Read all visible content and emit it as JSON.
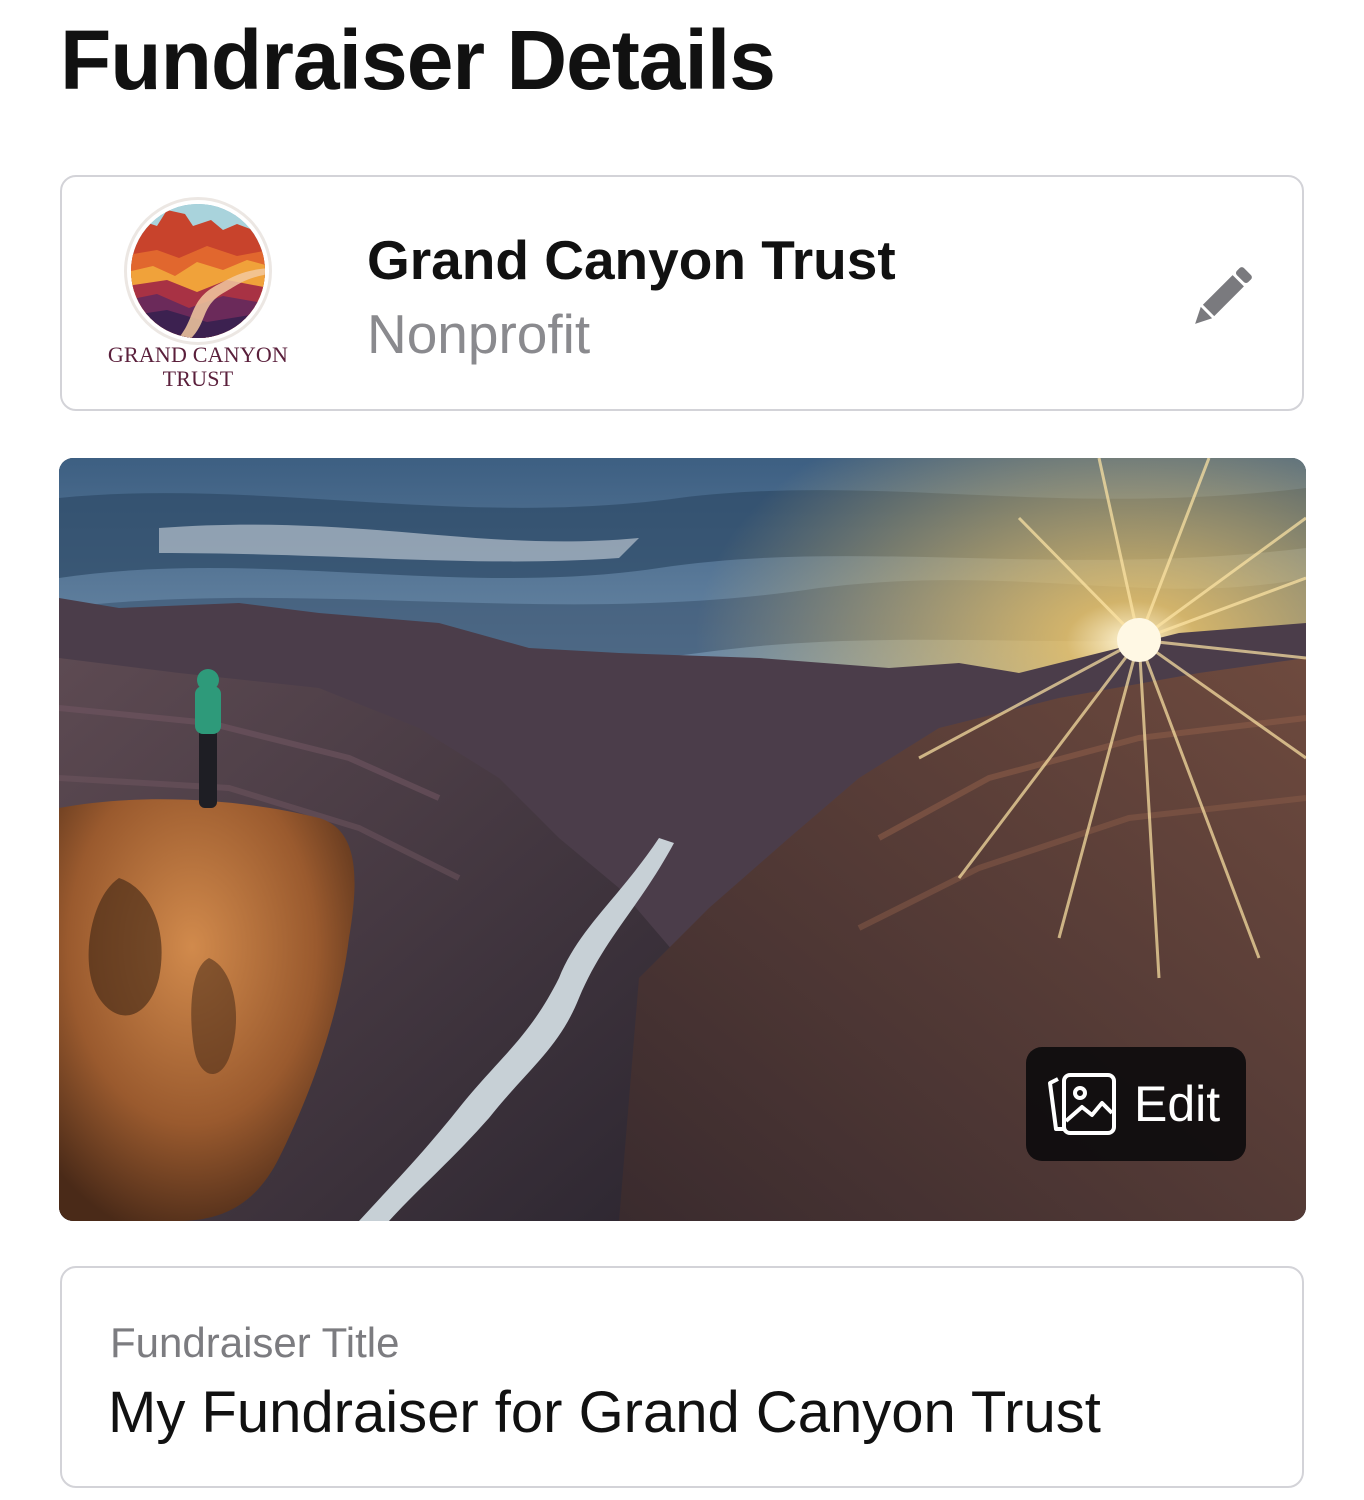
{
  "page": {
    "title": "Fundraiser Details"
  },
  "organization": {
    "name": "Grand Canyon Trust",
    "type": "Nonprofit",
    "logo_text_line1": "GRAND CANYON",
    "logo_text_line2": "TRUST",
    "edit_icon": "pencil-icon"
  },
  "cover_photo": {
    "description_icon": "photo-edit-icon",
    "edit_label": "Edit"
  },
  "fundraiser_title": {
    "label": "Fundraiser Title",
    "value": "My Fundraiser for Grand Canyon Trust"
  },
  "colors": {
    "text_primary": "#111111",
    "text_secondary": "#8a8a8e",
    "border": "#d3d3d8",
    "logo_maroon": "#5a1f3b",
    "overlay": "#08080a"
  }
}
